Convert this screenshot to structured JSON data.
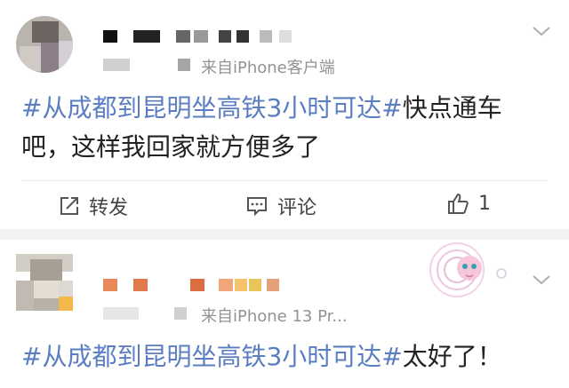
{
  "post1": {
    "source": "来自iPhone客户端",
    "hashtag": "#从成都到昆明坐高铁3小时可达#",
    "text": "快点通车吧，这样我回家就方便多了",
    "actions": {
      "repost": "转发",
      "comment": "评论",
      "like_count": "1"
    }
  },
  "post2": {
    "source": "来自iPhone 13 Pr...",
    "hashtag": "#从成都到昆明坐高铁3小时可达#",
    "text": "太好了！"
  },
  "icons": [
    "repost-icon",
    "comment-icon",
    "like-icon",
    "chevron-down-icon"
  ]
}
